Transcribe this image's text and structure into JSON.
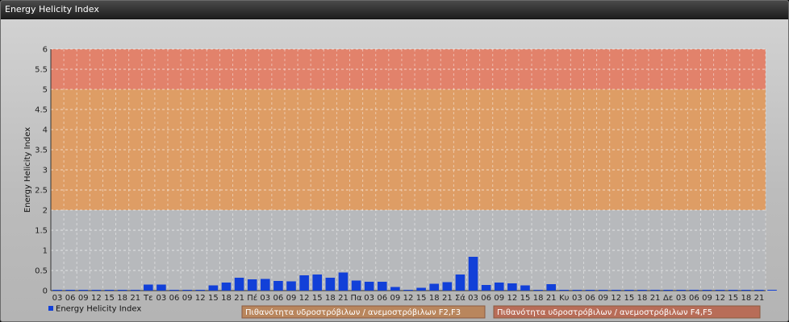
{
  "window": {
    "title": "Energy Helicity Index"
  },
  "chart_data": {
    "type": "bar",
    "title": "",
    "ylabel": "Energy Helicity Index",
    "ylim": [
      0,
      6
    ],
    "yticks": [
      "0",
      "0.5",
      "1",
      "1.5",
      "2",
      "2.5",
      "3",
      "3.5",
      "4",
      "4.5",
      "5",
      "5.5",
      "6"
    ],
    "grid": true,
    "legend": "bottom-left",
    "categories": [
      "03",
      "06",
      "09",
      "12",
      "15",
      "18",
      "21",
      "Τε",
      "03",
      "06",
      "09",
      "12",
      "15",
      "18",
      "21",
      "Πέ",
      "03",
      "06",
      "09",
      "12",
      "15",
      "18",
      "21",
      "Πα",
      "03",
      "06",
      "09",
      "12",
      "15",
      "18",
      "21",
      "Σά",
      "03",
      "06",
      "09",
      "12",
      "15",
      "18",
      "21",
      "Κυ",
      "03",
      "06",
      "09",
      "12",
      "15",
      "18",
      "21",
      "Δε",
      "03",
      "06",
      "09",
      "12",
      "15",
      "18",
      "21"
    ],
    "series": [
      {
        "name": "Energy Helicity Index",
        "color": "#1240d8",
        "values": [
          0.02,
          0.02,
          0.01,
          0.01,
          0.01,
          0.02,
          0.02,
          0.15,
          0.15,
          0.01,
          0.01,
          0.02,
          0.13,
          0.2,
          0.32,
          0.28,
          0.29,
          0.24,
          0.23,
          0.38,
          0.4,
          0.32,
          0.45,
          0.25,
          0.22,
          0.22,
          0.09,
          0.02,
          0.07,
          0.17,
          0.21,
          0.4,
          0.84,
          0.14,
          0.2,
          0.18,
          0.13,
          0.02,
          0.16,
          0.01,
          0.01,
          0.01,
          0.01,
          0.01,
          0.01,
          0.01,
          0.01,
          0.01,
          0.01,
          0.01,
          0.01,
          0.01,
          0.01,
          0.01,
          0.01,
          0.01
        ]
      }
    ],
    "bands": [
      {
        "from": 2,
        "to": 5,
        "label": "Πιθανότητα υδροστρόβιλων / ανεμοστρόβιλων F2,F3",
        "color": "#e19a5d"
      },
      {
        "from": 5,
        "to": 6,
        "label": "Πιθανότητα υδροστρόβιλων / ανεμοστρόβιλων F4,F5",
        "color": "#e57d64"
      }
    ]
  }
}
